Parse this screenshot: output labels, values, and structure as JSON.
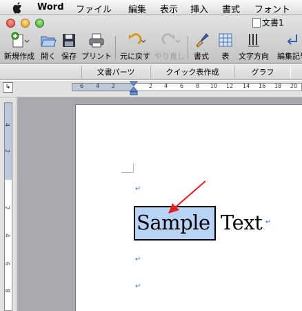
{
  "menubar": {
    "app_name": "Word",
    "items": [
      "ファイル",
      "編集",
      "表示",
      "挿入",
      "書式",
      "フォント"
    ]
  },
  "window": {
    "title": "文書1"
  },
  "toolbar": {
    "buttons": [
      {
        "label": "新規作成",
        "icon": "new-document-icon",
        "enabled": true
      },
      {
        "label": "開く",
        "icon": "open-folder-icon",
        "enabled": true
      },
      {
        "label": "保存",
        "icon": "save-floppy-icon",
        "enabled": true
      },
      {
        "label": "プリント",
        "icon": "printer-icon",
        "enabled": true
      },
      {
        "label": "元に戻す",
        "icon": "undo-icon",
        "enabled": true
      },
      {
        "label": "やり直し",
        "icon": "redo-icon",
        "enabled": false
      },
      {
        "label": "書式",
        "icon": "format-brush-icon",
        "enabled": true
      },
      {
        "label": "表",
        "icon": "table-grid-icon",
        "enabled": true
      },
      {
        "label": "文字方向",
        "icon": "text-direction-icon",
        "enabled": true
      },
      {
        "label": "編集記号",
        "icon": "edit-marks-icon",
        "enabled": true
      }
    ]
  },
  "gallery": {
    "tabs": [
      "文書パーツ",
      "クイック表作成",
      "グラフ"
    ]
  },
  "ruler": {
    "horizontal_numbers": [
      "6",
      "4",
      "2",
      "2",
      "4",
      "6",
      "8",
      "10",
      "12",
      "14",
      "16",
      "18",
      "20"
    ],
    "vertical_numbers": [
      "4",
      "2",
      "2",
      "4",
      "6",
      "8"
    ]
  },
  "document": {
    "selected_word": "Sample",
    "following_word": "Text",
    "paragraph_mark": "↵"
  },
  "colors": {
    "selection": "#b9d3f7",
    "arrow": "#e02020",
    "paragraph_mark": "#3b6fd8"
  }
}
